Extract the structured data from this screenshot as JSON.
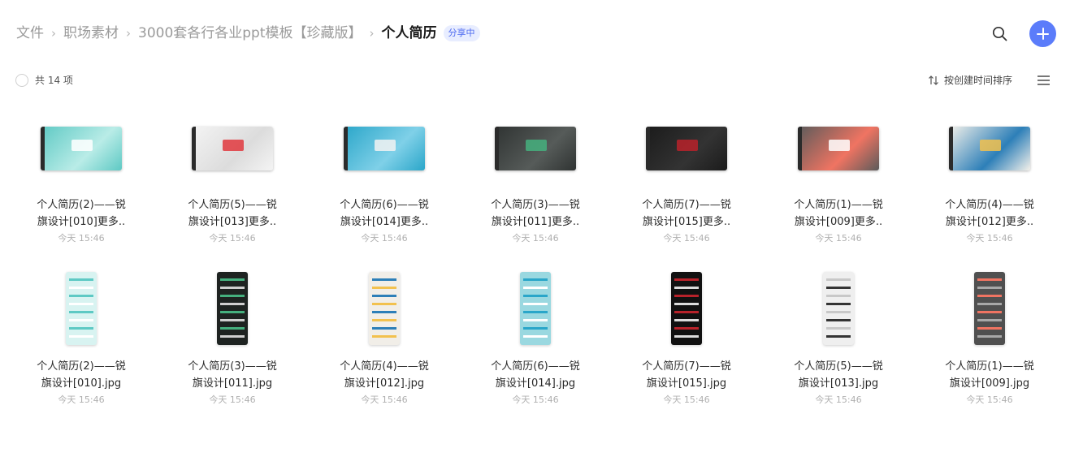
{
  "breadcrumb": {
    "items": [
      "文件",
      "职场素材",
      "3000套各行各业ppt模板【珍藏版】"
    ],
    "separator": "›",
    "current": "个人简历",
    "badge": "分享中"
  },
  "toolbar": {
    "count_text": "共 14 项",
    "sort_label": "按创建时间排序"
  },
  "icons": {
    "search": "search-icon",
    "add": "plus-icon",
    "sort": "sort-arrows-icon",
    "view": "list-view-icon",
    "checkbox": "circle-checkbox-icon"
  },
  "colors": {
    "accent": "#5b7cfa",
    "badge_bg": "#e8edff",
    "badge_text": "#4e6bf0",
    "muted_text": "#9a9a9a",
    "date_text": "#b0b0b0"
  },
  "files": [
    {
      "line1": "个人简历(2)——锐",
      "line2": "旗设计[010]更多..",
      "date": "今天 15:46",
      "kind": "ppt",
      "colors": [
        "#5ec9c4",
        "#b9ece7",
        "#ffffff"
      ]
    },
    {
      "line1": "个人简历(5)——锐",
      "line2": "旗设计[013]更多..",
      "date": "今天 15:46",
      "kind": "ppt",
      "colors": [
        "#f4f4f4",
        "#dcdcdc",
        "#e0383e"
      ]
    },
    {
      "line1": "个人简历(6)——锐",
      "line2": "旗设计[014]更多..",
      "date": "今天 15:46",
      "kind": "ppt",
      "colors": [
        "#2aa6c9",
        "#7fd0e8",
        "#f2f2f2"
      ]
    },
    {
      "line1": "个人简历(3)——锐",
      "line2": "旗设计[011]更多..",
      "date": "今天 15:46",
      "kind": "ppt",
      "colors": [
        "#2f3332",
        "#565b59",
        "#45b07e"
      ]
    },
    {
      "line1": "个人简历(7)——锐",
      "line2": "旗设计[015]更多..",
      "date": "今天 15:46",
      "kind": "ppt",
      "colors": [
        "#1b1b1b",
        "#333333",
        "#b8222a"
      ]
    },
    {
      "line1": "个人简历(1)——锐",
      "line2": "旗设计[009]更多..",
      "date": "今天 15:46",
      "kind": "ppt",
      "colors": [
        "#5b5b5b",
        "#f07462",
        "#ffffff"
      ]
    },
    {
      "line1": "个人简历(4)——锐",
      "line2": "旗设计[012]更多..",
      "date": "今天 15:46",
      "kind": "ppt",
      "colors": [
        "#f4f1ea",
        "#2d7fb8",
        "#f2c14e"
      ]
    },
    {
      "line1": "个人简历(2)——锐",
      "line2": "旗设计[010].jpg",
      "date": "今天 15:46",
      "kind": "jpg",
      "colors": [
        "#d8f3f1",
        "#5ec9c4",
        "#ffffff"
      ]
    },
    {
      "line1": "个人简历(3)——锐",
      "line2": "旗设计[011].jpg",
      "date": "今天 15:46",
      "kind": "jpg",
      "colors": [
        "#1e2321",
        "#45b07e",
        "#cfcfcf"
      ]
    },
    {
      "line1": "个人简历(4)——锐",
      "line2": "旗设计[012].jpg",
      "date": "今天 15:46",
      "kind": "jpg",
      "colors": [
        "#f1eee8",
        "#2d7fb8",
        "#f2c14e"
      ]
    },
    {
      "line1": "个人简历(6)——锐",
      "line2": "旗设计[014].jpg",
      "date": "今天 15:46",
      "kind": "jpg",
      "colors": [
        "#9ad8e0",
        "#2aa6c9",
        "#ffffff"
      ]
    },
    {
      "line1": "个人简历(7)——锐",
      "line2": "旗设计[015].jpg",
      "date": "今天 15:46",
      "kind": "jpg",
      "colors": [
        "#111111",
        "#b8222a",
        "#dcdcdc"
      ]
    },
    {
      "line1": "个人简历(5)——锐",
      "line2": "旗设计[013].jpg",
      "date": "今天 15:46",
      "kind": "jpg",
      "colors": [
        "#efefef",
        "#c8c8c8",
        "#333333"
      ]
    },
    {
      "line1": "个人简历(1)——锐",
      "line2": "旗设计[009].jpg",
      "date": "今天 15:46",
      "kind": "jpg",
      "colors": [
        "#505050",
        "#f07462",
        "#a8a8a8"
      ]
    }
  ]
}
